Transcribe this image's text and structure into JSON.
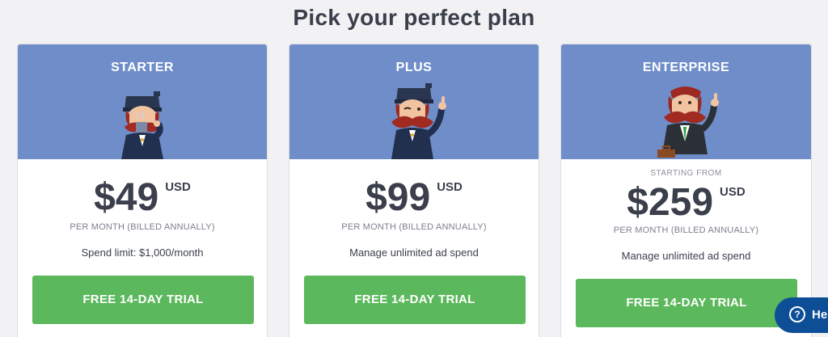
{
  "page": {
    "title": "Pick your perfect plan"
  },
  "plans": [
    {
      "name": "STARTER",
      "starting_from": "",
      "price": "$49",
      "currency": "USD",
      "billing": "PER MONTH (BILLED ANNUALLY)",
      "feature": "Spend limit: $1,000/month",
      "cta": "FREE 14-DAY TRIAL",
      "mascot": "mascot-drinking-coffee-icon"
    },
    {
      "name": "PLUS",
      "starting_from": "",
      "price": "$99",
      "currency": "USD",
      "billing": "PER MONTH (BILLED ANNUALLY)",
      "feature": "Manage unlimited ad spend",
      "cta": "FREE 14-DAY TRIAL",
      "mascot": "mascot-winking-thumbs-up-icon"
    },
    {
      "name": "ENTERPRISE",
      "starting_from": "STARTING FROM",
      "price": "$259",
      "currency": "USD",
      "billing": "PER MONTH (BILLED ANNUALLY)",
      "feature": "Manage unlimited ad spend",
      "cta": "FREE 14-DAY TRIAL",
      "mascot": "mascot-businessman-thumbs-up-icon"
    }
  ],
  "help_widget": {
    "label": "Hel",
    "icon": "question-circle-icon"
  },
  "colors": {
    "header_blue": "#6f8ec9",
    "cta_green": "#5cb85c",
    "help_navy": "#0d4e97",
    "text_dark": "#3a3f4b"
  }
}
